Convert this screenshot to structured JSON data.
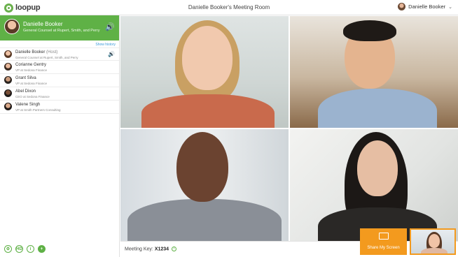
{
  "brand": {
    "logo_text": "loopup",
    "accent": "#5fb146",
    "share_color": "#f39a1e"
  },
  "header": {
    "room_title": "Danielle Booker's Meeting Room",
    "user_name": "Danielle Booker",
    "user_menu_icon": "chevron-down-icon"
  },
  "speaker": {
    "name": "Danielle Booker",
    "title": "General Counsel at Rupert, Smith, and Perry",
    "icon": "volume-icon"
  },
  "show_history_label": "Show history",
  "participants": [
    {
      "name": "Danielle Booker",
      "host_tag": "(Host)",
      "role": "General Counsel at Rupert, Smith, and Perry"
    },
    {
      "name": "Corianne Gentry",
      "role": "VP at Sedona Finance"
    },
    {
      "name": "Grant Silva",
      "role": "VP at Sedona Finance"
    },
    {
      "name": "Abel Dixon",
      "role": "CEO at Sedona Finance"
    },
    {
      "name": "Valene Singh",
      "role": "VP at Smith Partners Consulting"
    }
  ],
  "tools": [
    "settings-icon",
    "hd-icon",
    "info-icon",
    "add-icon"
  ],
  "footer": {
    "meeting_key_label": "Meeting Key:",
    "meeting_key_value": "X1234"
  },
  "share": {
    "label": "Share My Screen"
  }
}
